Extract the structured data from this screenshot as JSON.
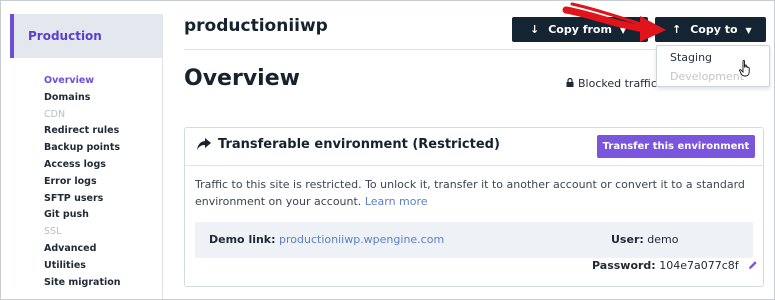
{
  "sidebar": {
    "environment_label": "Production",
    "items": [
      {
        "label": "Overview",
        "state": "active"
      },
      {
        "label": "Domains",
        "state": "normal"
      },
      {
        "label": "CDN",
        "state": "disabled"
      },
      {
        "label": "Redirect rules",
        "state": "normal"
      },
      {
        "label": "Backup points",
        "state": "normal"
      },
      {
        "label": "Access logs",
        "state": "normal"
      },
      {
        "label": "Error logs",
        "state": "normal"
      },
      {
        "label": "SFTP users",
        "state": "normal"
      },
      {
        "label": "Git push",
        "state": "normal"
      },
      {
        "label": "SSL",
        "state": "disabled"
      },
      {
        "label": "Advanced",
        "state": "normal"
      },
      {
        "label": "Utilities",
        "state": "normal"
      },
      {
        "label": "Site migration",
        "state": "normal"
      }
    ]
  },
  "header": {
    "site_name": "productioniiwp",
    "copy_from_label": "Copy from",
    "copy_to_label": "Copy to",
    "copy_to_menu": [
      "Staging",
      "Development"
    ]
  },
  "overview": {
    "title": "Overview",
    "blocked_traffic_label": "Blocked traffic:"
  },
  "card": {
    "title": "Transferable environment (Restricted)",
    "transfer_button": "Transfer this environment",
    "description": "Traffic to this site is restricted. To unlock it, transfer it to another account or convert it to a standard environment on your account.",
    "learn_more": "Learn more",
    "demo_link_label": "Demo link:",
    "demo_link_value": "productioniiwp.wpengine.com",
    "user_label": "User:",
    "user_value": "demo",
    "password_label": "Password:",
    "password_value": "104e7a077c8f"
  },
  "colors": {
    "accent": "#6d4fd7",
    "dark_button": "#152433",
    "transfer_button": "#7a55de",
    "link": "#5b7fc9",
    "annotation_arrow": "#e0141b"
  },
  "icons": [
    "down-arrow-icon",
    "up-arrow-icon",
    "caret-down-icon",
    "lock-icon",
    "share-arrow-icon",
    "pencil-icon",
    "pointer-cursor-icon",
    "annotation-arrow-icon"
  ]
}
